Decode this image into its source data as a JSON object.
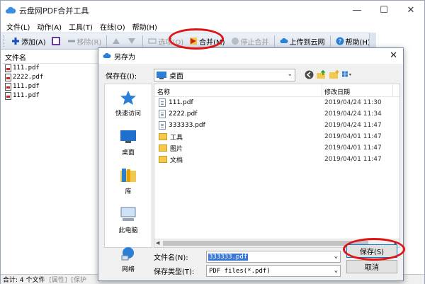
{
  "app": {
    "title": "云盘网PDF合并工具",
    "window_min": "—",
    "window_max": "☐",
    "window_close": "✕"
  },
  "menu": {
    "items": [
      "文件(L)",
      "动作(A)",
      "工具(T)",
      "在线(O)",
      "帮助(H)"
    ]
  },
  "toolbar": {
    "add": "添加(A)",
    "remove": "移除(R)",
    "options": "选项(O)",
    "merge": "合并(M)",
    "stop": "停止合并",
    "upload": "上传到云网",
    "help": "帮助(H)"
  },
  "file_list": {
    "header": "文件名",
    "items": [
      "111.pdf",
      "2222.pdf",
      "111.pdf",
      "111.pdf"
    ]
  },
  "status": {
    "count": "合计: 4 个文件",
    "seg2": "[属性]",
    "seg3": "[保护"
  },
  "dialog": {
    "title": "另存为",
    "close": "✕",
    "save_in_label": "保存在(I):",
    "save_in_value": "桌面",
    "places": [
      "快速访问",
      "桌面",
      "库",
      "此电脑",
      "网络"
    ],
    "columns": {
      "name": "名称",
      "date": "修改日期"
    },
    "files": [
      {
        "name": "111.pdf",
        "date": "2019/04/24 11:30",
        "type": "doc"
      },
      {
        "name": "2222.pdf",
        "date": "2019/04/24 11:34",
        "type": "doc"
      },
      {
        "name": "333333.pdf",
        "date": "2019/04/24 11:47",
        "type": "doc"
      },
      {
        "name": "工具",
        "date": "2019/04/01 11:47",
        "type": "folder"
      },
      {
        "name": "图片",
        "date": "2019/04/01 11:47",
        "type": "folder"
      },
      {
        "name": "文档",
        "date": "2019/04/01 11:47",
        "type": "folder"
      }
    ],
    "filename_label": "文件名(N):",
    "filename_value": "333333.pdf",
    "filetype_label": "保存类型(T):",
    "filetype_value": "PDF files(*.pdf)",
    "save_button": "保存(S)",
    "cancel_button": "取消"
  },
  "colors": {
    "annotation": "#e01414",
    "selection": "#3a78d6"
  }
}
